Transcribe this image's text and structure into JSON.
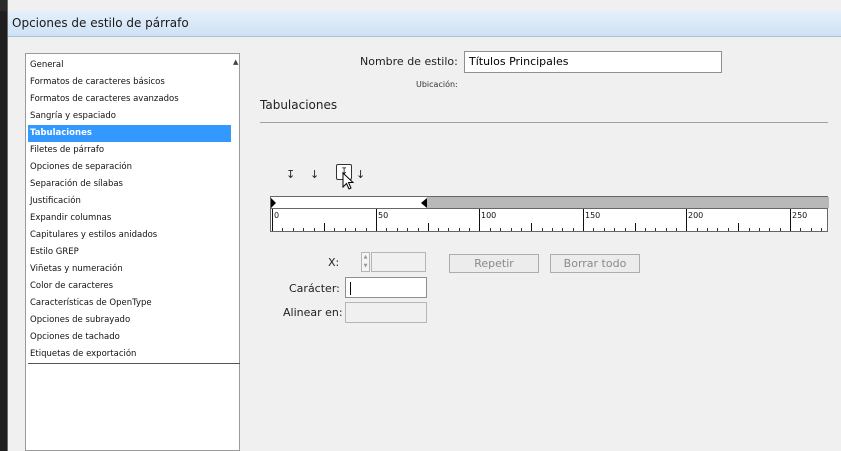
{
  "window": {
    "title": "Opciones de estilo de párrafo"
  },
  "sidebar": {
    "items": [
      {
        "label": "General",
        "selected": false
      },
      {
        "label": "Formatos de caracteres básicos",
        "selected": false
      },
      {
        "label": "Formatos de caracteres avanzados",
        "selected": false
      },
      {
        "label": "Sangría y espaciado",
        "selected": false
      },
      {
        "label": "Tabulaciones",
        "selected": true
      },
      {
        "label": "Filetes de párrafo",
        "selected": false
      },
      {
        "label": "Opciones de separación",
        "selected": false
      },
      {
        "label": "Separación de sílabas",
        "selected": false
      },
      {
        "label": "Justificación",
        "selected": false
      },
      {
        "label": "Expandir columnas",
        "selected": false
      },
      {
        "label": "Capitulares y estilos anidados",
        "selected": false
      },
      {
        "label": "Estilo GREP",
        "selected": false
      },
      {
        "label": "Viñetas y numeración",
        "selected": false
      },
      {
        "label": "Color de caracteres",
        "selected": false
      },
      {
        "label": "Características de OpenType",
        "selected": false
      },
      {
        "label": "Opciones de subrayado",
        "selected": false
      },
      {
        "label": "Opciones de tachado",
        "selected": false
      },
      {
        "label": "Etiquetas de exportación",
        "selected": false
      }
    ]
  },
  "main": {
    "style_name_label": "Nombre de estilo:",
    "style_name_value": "Títulos Principales",
    "location_label": "Ubicación:",
    "section_title": "Tabulaciones",
    "tab_types": [
      {
        "icon": "left-tab-icon",
        "glyph": "↧"
      },
      {
        "icon": "center-tab-icon",
        "glyph": "↓"
      },
      {
        "icon": "right-tab-icon",
        "glyph": "↧"
      },
      {
        "icon": "decimal-tab-icon",
        "glyph": "↓"
      }
    ],
    "ruler_labels": [
      "0",
      "50",
      "100",
      "150",
      "200",
      "250"
    ],
    "x_label": "X:",
    "x_value": "",
    "repeat_button": "Repetir",
    "clear_all_button": "Borrar todo",
    "character_label": "Carácter:",
    "character_value": "",
    "align_on_label": "Alinear en:",
    "align_on_value": ""
  },
  "colors": {
    "selection": "#3399ff",
    "title_bar": "#d9e8f7"
  }
}
